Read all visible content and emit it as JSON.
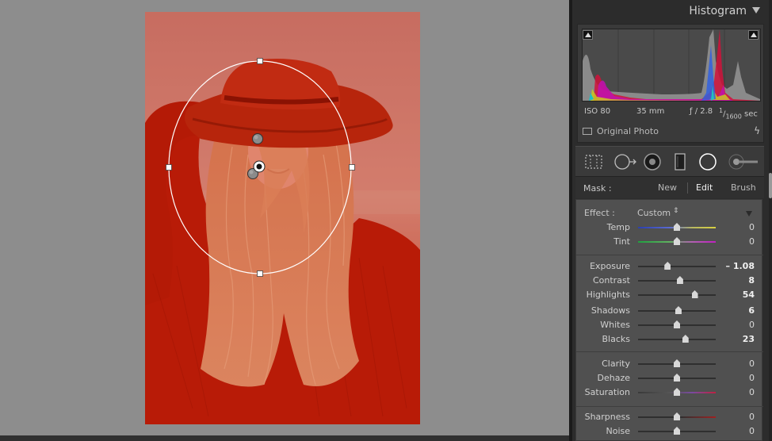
{
  "canvas": {
    "photo_alt": "",
    "selected_pin": 1
  },
  "histogram": {
    "title": "Histogram",
    "exif": {
      "iso": "ISO 80",
      "focal": "35 mm",
      "aperture": "ƒ / 2.8",
      "shutter_num": "1",
      "shutter_den": "1600",
      "shutter_unit": "sec"
    },
    "original_photo": "Original Photo"
  },
  "tools": [
    "crop-overlay-icon",
    "spot-removal-icon",
    "red-eye-icon",
    "graduated-filter-icon",
    "radial-filter-icon",
    "adjustment-brush-icon"
  ],
  "mask": {
    "label": "Mask :",
    "new": "New",
    "edit": "Edit",
    "brush": "Brush"
  },
  "effect": {
    "label": "Effect :",
    "value": "Custom"
  },
  "sliders": [
    {
      "key": "temp",
      "label": "Temp",
      "value": "0",
      "position": 0.5,
      "bold": false,
      "track": "temp"
    },
    {
      "key": "tint",
      "label": "Tint",
      "value": "0",
      "position": 0.5,
      "bold": false,
      "track": "tint"
    },
    {
      "key": "exposure",
      "label": "Exposure",
      "value": "– 1.08",
      "position": 0.38,
      "bold": true,
      "track": "plain"
    },
    {
      "key": "contrast",
      "label": "Contrast",
      "value": "8",
      "position": 0.54,
      "bold": true,
      "track": "plain"
    },
    {
      "key": "highlights",
      "label": "Highlights",
      "value": "54",
      "position": 0.73,
      "bold": true,
      "track": "plain"
    },
    {
      "key": "shadows",
      "label": "Shadows",
      "value": "6",
      "position": 0.52,
      "bold": true,
      "track": "plain"
    },
    {
      "key": "whites",
      "label": "Whites",
      "value": "0",
      "position": 0.5,
      "bold": false,
      "track": "plain"
    },
    {
      "key": "blacks",
      "label": "Blacks",
      "value": "23",
      "position": 0.61,
      "bold": true,
      "track": "plain"
    },
    {
      "key": "clarity",
      "label": "Clarity",
      "value": "0",
      "position": 0.5,
      "bold": false,
      "track": "plain"
    },
    {
      "key": "dehaze",
      "label": "Dehaze",
      "value": "0",
      "position": 0.5,
      "bold": false,
      "track": "plain"
    },
    {
      "key": "saturation",
      "label": "Saturation",
      "value": "0",
      "position": 0.5,
      "bold": false,
      "track": "saturation"
    },
    {
      "key": "sharpness",
      "label": "Sharpness",
      "value": "0",
      "position": 0.5,
      "bold": false,
      "track": "sharp"
    },
    {
      "key": "noise",
      "label": "Noise",
      "value": "0",
      "position": 0.5,
      "bold": false,
      "track": "plain"
    }
  ],
  "colors": {
    "panel_bg": "#2c2c2c",
    "effects_bg": "#505050",
    "canvas_bg": "#8d8d8d",
    "mask_overlay": "#c41a00"
  }
}
